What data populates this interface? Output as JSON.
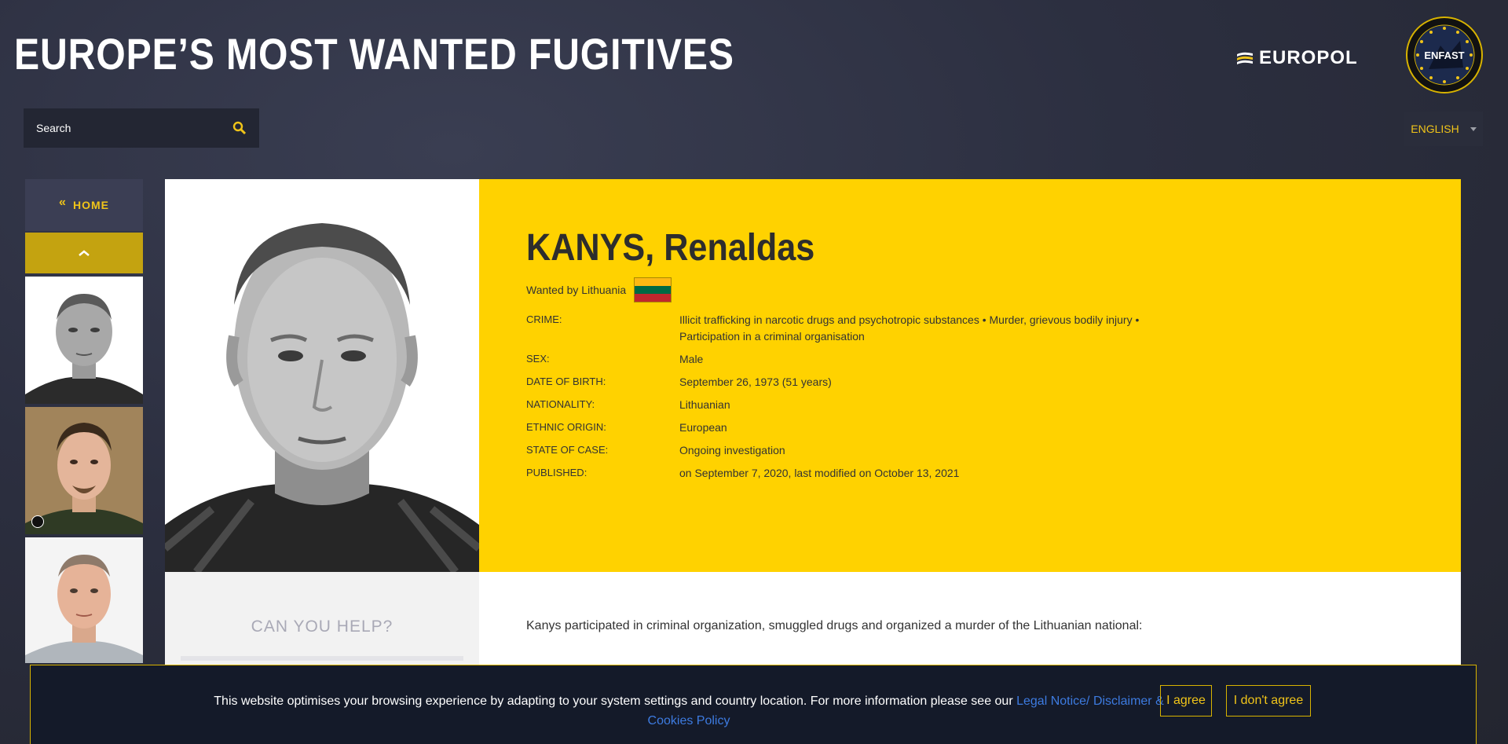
{
  "header": {
    "title": "EUROPE’S MOST WANTED FUGITIVES",
    "europol_logo": "EUROPOL",
    "enfast_logo": "ENFAST"
  },
  "search": {
    "label": "Search",
    "icon": "search-icon"
  },
  "language": {
    "selected": "ENGLISH"
  },
  "sidebar": {
    "home_label": "HOME",
    "home_chevron": "«",
    "up_icon": "chevron-up-icon",
    "thumbnail_count": 3
  },
  "profile": {
    "name": "KANYS, Renaldas",
    "wanted_by": "Wanted by Lithuania",
    "flag_colors": [
      "#fdb913",
      "#006a44",
      "#c1272d"
    ],
    "fields": [
      {
        "label": "CRIME:",
        "value": "Illicit trafficking in narcotic drugs and psychotropic substances • Murder, grievous bodily injury • Participation in a criminal organisation"
      },
      {
        "label": "SEX:",
        "value": "Male"
      },
      {
        "label": "DATE OF BIRTH:",
        "value": "September 26, 1973 (51 years)"
      },
      {
        "label": "NATIONALITY:",
        "value": "Lithuanian"
      },
      {
        "label": "ETHNIC ORIGIN:",
        "value": "European"
      },
      {
        "label": "STATE OF CASE:",
        "value": "Ongoing investigation"
      },
      {
        "label": "PUBLISHED:",
        "value": "on September 7, 2020, last modified on October 13, 2021"
      }
    ]
  },
  "help": {
    "title": "CAN YOU HELP?"
  },
  "description": "Kanys participated in criminal organization, smuggled drugs and organized a murder of the Lithuanian national:",
  "cookie": {
    "text": "This website optimises your browsing experience by adapting to your system settings and country location. For more information please see our ",
    "link": "Legal Notice/ Disclaimer & Cookies Policy",
    "agree": "I agree",
    "disagree": "I don't agree"
  },
  "colors": {
    "accent": "#f0c419",
    "info_bg": "#ffd200",
    "dark_bg": "#2c2f40"
  }
}
